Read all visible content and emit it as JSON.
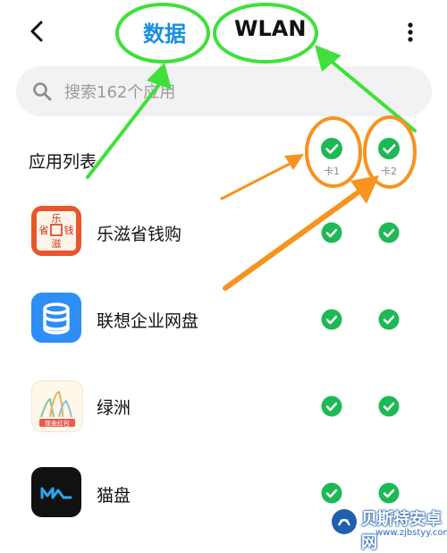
{
  "header": {
    "tab_data": "数据",
    "tab_wlan": "WLAN"
  },
  "search": {
    "placeholder": "搜索162个应用"
  },
  "list": {
    "title": "应用列表",
    "col_sim1": "卡1",
    "col_sim2": "卡2"
  },
  "apps": [
    {
      "name": "乐滋省钱购",
      "icon": "lezi-icon",
      "sim1": true,
      "sim2": true
    },
    {
      "name": "联想企业网盘",
      "icon": "lenovo-box-icon",
      "sim1": true,
      "sim2": true
    },
    {
      "name": "绿洲",
      "icon": "oasis-icon",
      "sim1": true,
      "sim2": true
    },
    {
      "name": "猫盘",
      "icon": "maopan-icon",
      "sim1": true,
      "sim2": true
    }
  ],
  "lezi_icon_chars": {
    "top": "乐",
    "left": "省",
    "right": "钱",
    "bottom": "滋"
  },
  "oasis_icon_caption": "现金红包",
  "watermark": {
    "name": "贝斯特安卓网",
    "url": "www.zjbstyy.com"
  },
  "colors": {
    "accent": "#1a8fe0",
    "check_green": "#1db954",
    "annotation_green": "#3fe03a",
    "annotation_orange": "#f7931e"
  }
}
